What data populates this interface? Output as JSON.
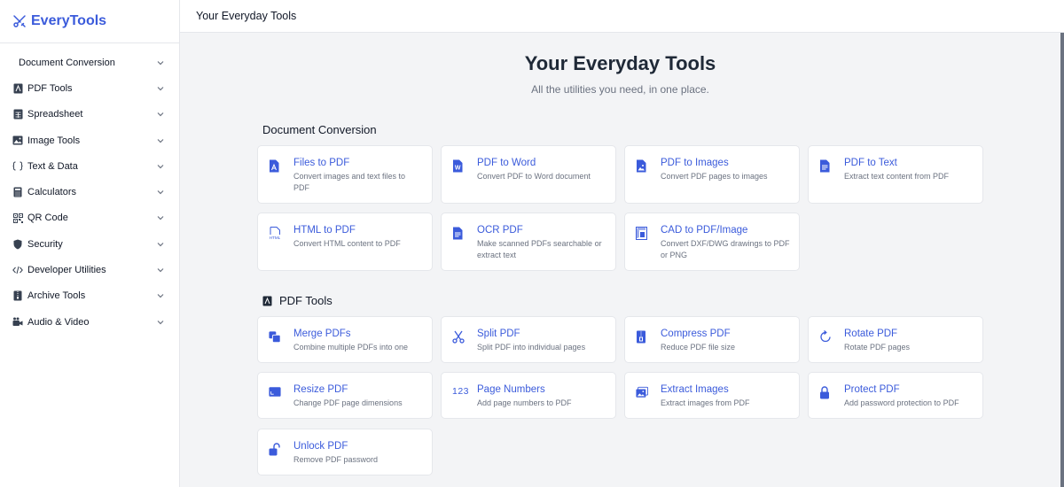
{
  "brand": {
    "name": "EveryTools"
  },
  "topbar": {
    "title": "Your Everyday Tools"
  },
  "sidebar": {
    "items": [
      {
        "label": "Document Conversion",
        "icon": "none"
      },
      {
        "label": "PDF Tools",
        "icon": "pdf-icon"
      },
      {
        "label": "Spreadsheet",
        "icon": "spreadsheet-icon"
      },
      {
        "label": "Image Tools",
        "icon": "image-icon"
      },
      {
        "label": "Text & Data",
        "icon": "braces-icon"
      },
      {
        "label": "Calculators",
        "icon": "calculator-icon"
      },
      {
        "label": "QR Code",
        "icon": "qr-code-icon"
      },
      {
        "label": "Security",
        "icon": "shield-icon"
      },
      {
        "label": "Developer Utilities",
        "icon": "code-icon"
      },
      {
        "label": "Archive Tools",
        "icon": "archive-icon"
      },
      {
        "label": "Audio & Video",
        "icon": "video-icon"
      }
    ]
  },
  "hero": {
    "title": "Your Everyday Tools",
    "subtitle": "All the utilities you need, in one place."
  },
  "sections": [
    {
      "title": "Document Conversion",
      "cards": [
        {
          "title": "Files to PDF",
          "desc": "Convert images and text files to PDF",
          "icon": "pdf-file-icon"
        },
        {
          "title": "PDF to Word",
          "desc": "Convert PDF to Word document",
          "icon": "word-icon",
          "icon_text": "W"
        },
        {
          "title": "PDF to Images",
          "desc": "Convert PDF pages to images",
          "icon": "image-file-icon"
        },
        {
          "title": "PDF to Text",
          "desc": "Extract text content from PDF",
          "icon": "text-file-icon"
        },
        {
          "title": "HTML to PDF",
          "desc": "Convert HTML content to PDF",
          "icon": "html-file-icon",
          "icon_text": "HTML"
        },
        {
          "title": "OCR PDF",
          "desc": "Make scanned PDFs searchable or extract text",
          "icon": "ocr-icon"
        },
        {
          "title": "CAD to PDF/Image",
          "desc": "Convert DXF/DWG drawings to PDF or PNG",
          "icon": "cad-icon"
        }
      ]
    },
    {
      "title": "PDF Tools",
      "cards": [
        {
          "title": "Merge PDFs",
          "desc": "Combine multiple PDFs into one",
          "icon": "merge-icon"
        },
        {
          "title": "Split PDF",
          "desc": "Split PDF into individual pages",
          "icon": "scissors-icon"
        },
        {
          "title": "Compress PDF",
          "desc": "Reduce PDF file size",
          "icon": "compress-icon"
        },
        {
          "title": "Rotate PDF",
          "desc": "Rotate PDF pages",
          "icon": "rotate-icon"
        },
        {
          "title": "Resize PDF",
          "desc": "Change PDF page dimensions",
          "icon": "resize-icon"
        },
        {
          "title": "Page Numbers",
          "desc": "Add page numbers to PDF",
          "icon": "numbers-icon",
          "icon_text": "123"
        },
        {
          "title": "Extract Images",
          "desc": "Extract images from PDF",
          "icon": "images-icon"
        },
        {
          "title": "Protect PDF",
          "desc": "Add password protection to PDF",
          "icon": "lock-icon"
        },
        {
          "title": "Unlock PDF",
          "desc": "Remove PDF password",
          "icon": "unlock-icon"
        }
      ]
    }
  ],
  "colors": {
    "accent": "#3b5bdb",
    "background": "#f3f4f6"
  }
}
